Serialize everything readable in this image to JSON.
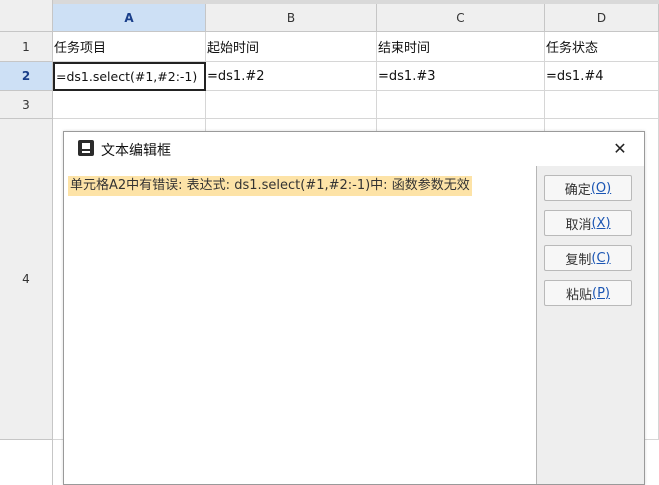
{
  "columns": [
    "A",
    "B",
    "C",
    "D"
  ],
  "rows": [
    "1",
    "2",
    "3",
    "4"
  ],
  "cells": {
    "A1": "任务项目",
    "B1": "起始时间",
    "C1": "结束时间",
    "D1": "任务状态",
    "A2": "=ds1.select(#1,#2:-1)",
    "B2": "=ds1.#2",
    "C2": "=ds1.#3",
    "D2": "=ds1.#4"
  },
  "selection": {
    "column": "A",
    "row": "2"
  },
  "dialog": {
    "title": "文本编辑框",
    "close_icon": "close-icon",
    "error_text": "单元格A2中有错误: 表达式: ds1.select(#1,#2:-1)中: 函数参数无效",
    "buttons": [
      {
        "label": "确定",
        "key": "(O)"
      },
      {
        "label": "取消",
        "key": "(X)"
      },
      {
        "label": "复制",
        "key": "(C)"
      },
      {
        "label": "粘贴",
        "key": "(P)"
      }
    ]
  },
  "colors": {
    "selected_header": "#cde0f5",
    "error_highlight": "#fde3a7",
    "header_bg": "#efefef"
  }
}
